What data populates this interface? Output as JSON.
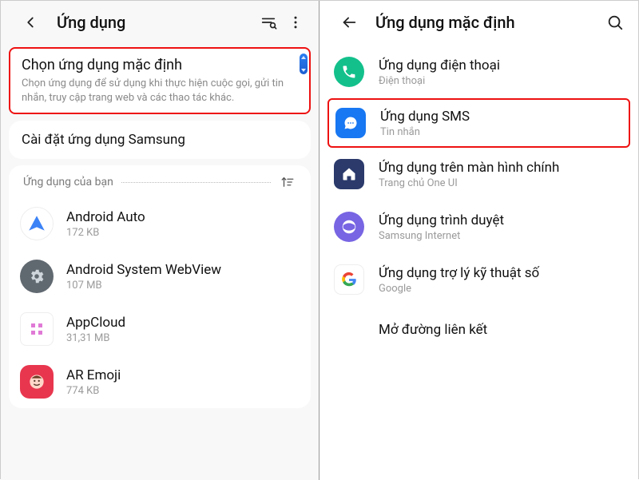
{
  "left": {
    "title": "Ứng dụng",
    "defaultCard": {
      "title": "Chọn ứng dụng mặc định",
      "sub": "Chọn ứng dụng để sử dụng khi thực hiện cuộc gọi, gửi tin nhắn, truy cập trang web và các thao tác khác."
    },
    "samsungSettings": "Cài đặt ứng dụng Samsung",
    "yourApps": "Ứng dụng của bạn",
    "apps": [
      {
        "name": "Android Auto",
        "meta": "172 KB"
      },
      {
        "name": "Android System WebView",
        "meta": "107 MB"
      },
      {
        "name": "AppCloud",
        "meta": "31,31 MB"
      },
      {
        "name": "AR Emoji",
        "meta": "774 KB"
      }
    ]
  },
  "right": {
    "title": "Ứng dụng mặc định",
    "items": [
      {
        "name": "Ứng dụng điện thoại",
        "meta": "Điện thoại"
      },
      {
        "name": "Ứng dụng SMS",
        "meta": "Tin nhắn"
      },
      {
        "name": "Ứng dụng trên màn hình chính",
        "meta": "Trang chủ One UI"
      },
      {
        "name": "Ứng dụng trình duyệt",
        "meta": "Samsung Internet"
      },
      {
        "name": "Ứng dụng trợ lý kỹ thuật số",
        "meta": "Google"
      }
    ],
    "openLinks": "Mở đường liên kết"
  }
}
